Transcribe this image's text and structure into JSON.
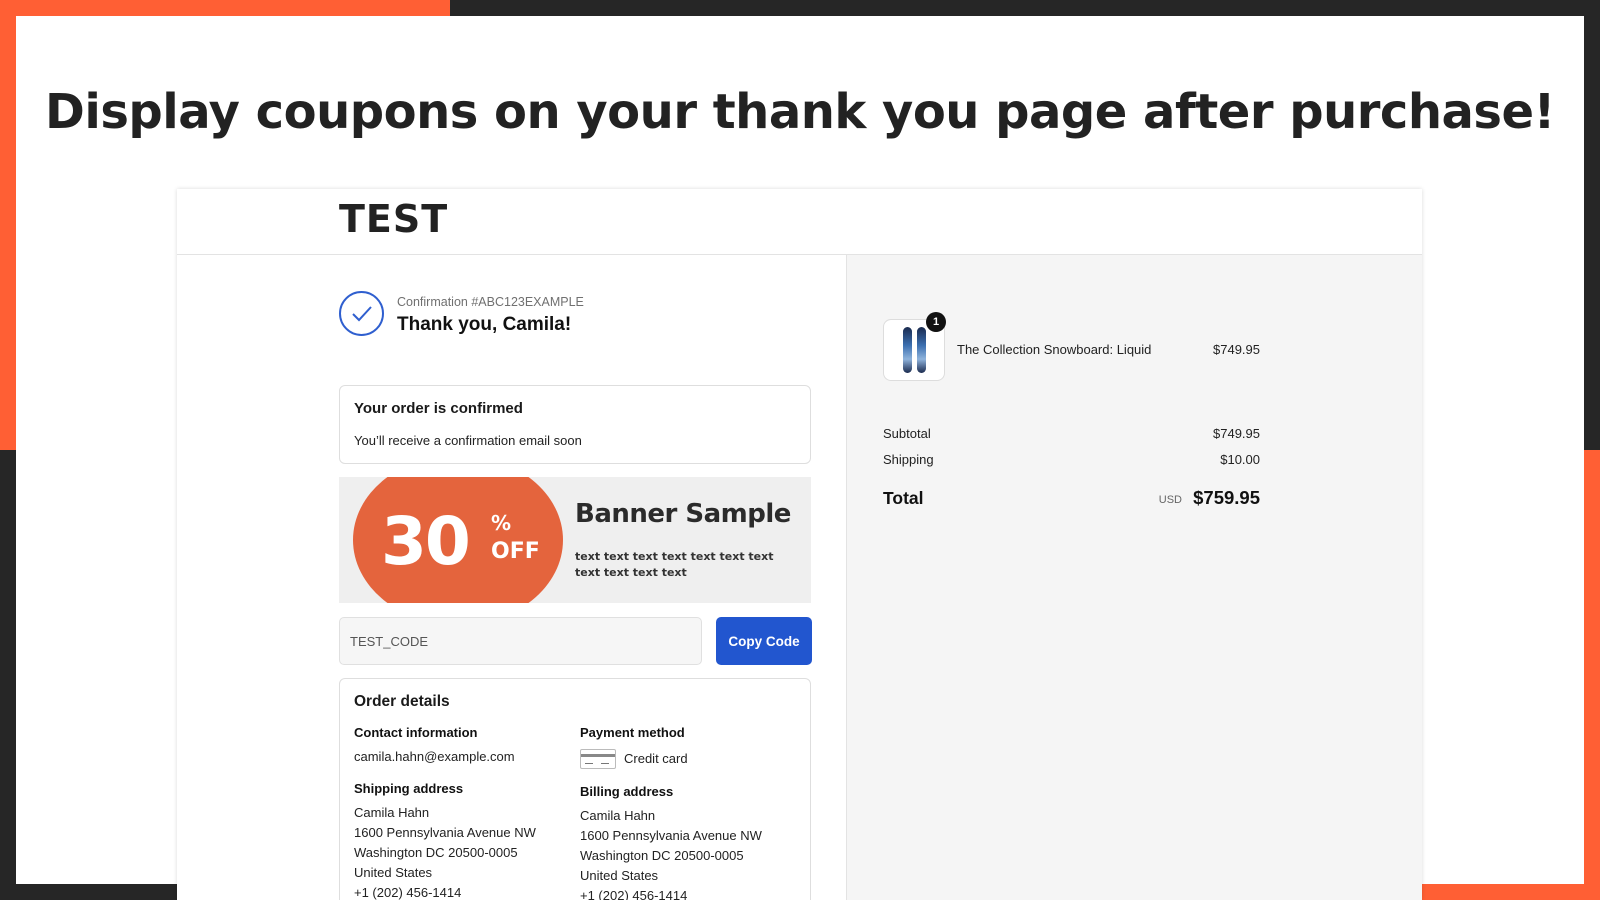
{
  "headline": "Display coupons on your thank you page after purchase!",
  "store": {
    "logo": "TEST"
  },
  "confirmation": {
    "number": "Confirmation #ABC123EXAMPLE",
    "greeting": "Thank you, Camila!"
  },
  "order_status": {
    "title": "Your order is confirmed",
    "message": "You’ll receive a confirmation email soon"
  },
  "banner": {
    "discount": "30",
    "percent": "%",
    "off": "OFF",
    "title": "Banner Sample",
    "body": "text text text text text text text text text text text"
  },
  "coupon": {
    "code": "TEST_CODE",
    "copy_label": "Copy Code"
  },
  "details": {
    "title": "Order details",
    "contact_label": "Contact information",
    "contact_email": "camila.hahn@example.com",
    "payment_label": "Payment method",
    "payment_method": "Credit card",
    "shipping_label": "Shipping address",
    "billing_label": "Billing address",
    "shipping": {
      "name": "Camila Hahn",
      "street": "1600 Pennsylvania Avenue NW",
      "city": "Washington DC 20500-0005",
      "country": "United States",
      "phone": "+1 (202) 456-1414"
    },
    "billing": {
      "name": "Camila Hahn",
      "street": "1600 Pennsylvania Avenue NW",
      "city": "Washington DC 20500-0005",
      "country": "United States",
      "phone": "+1 (202) 456-1414"
    }
  },
  "summary": {
    "item": {
      "name": "The Collection Snowboard: Liquid",
      "price": "$749.95",
      "qty": "1"
    },
    "subtotal_label": "Subtotal",
    "subtotal": "$749.95",
    "shipping_label": "Shipping",
    "shipping": "$10.00",
    "total_label": "Total",
    "currency": "USD",
    "total": "$759.95"
  },
  "colors": {
    "accent_orange": "#ff5f34",
    "banner_orange": "#e4643d",
    "button_blue": "#2256cf",
    "dark_frame": "#262626"
  }
}
